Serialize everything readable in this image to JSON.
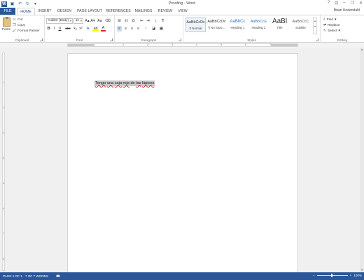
{
  "window": {
    "title": "Proofing - Word",
    "minimize": "–",
    "restore": "❐",
    "close": "✕",
    "help": "?",
    "ribbon_opts": "⊡"
  },
  "qat": {
    "word": "W",
    "save": "▣",
    "undo": "↶",
    "redo": "↻",
    "more": "▾"
  },
  "tabs": [
    {
      "label": "FILE"
    },
    {
      "label": "HOME"
    },
    {
      "label": "INSERT"
    },
    {
      "label": "DESIGN"
    },
    {
      "label": "PAGE LAYOUT"
    },
    {
      "label": "REFERENCES"
    },
    {
      "label": "MAILINGS"
    },
    {
      "label": "REVIEW"
    },
    {
      "label": "VIEW"
    }
  ],
  "user": {
    "name": "Brian Undendahl"
  },
  "clipboard": {
    "paste": "Paste",
    "cut": "Cut",
    "copy": "Copy",
    "format_painter": "Format Painter",
    "label": "Clipboard"
  },
  "font": {
    "name": "Calibri (Body)",
    "size": "11",
    "label": "Font",
    "grow": "A▴",
    "shrink": "A▾",
    "case": "Aa",
    "clear": "⌫",
    "bold": "B",
    "italic": "I",
    "underline": "U",
    "strike": "abc",
    "subscript": "x₂",
    "superscript": "x²",
    "effects": "A",
    "highlight": "ab",
    "color": "A"
  },
  "paragraph": {
    "label": "Paragraph",
    "bullets": "☰",
    "numbering": "☷",
    "multilevel": "☲",
    "decrease": "⇤",
    "increase": "⇥",
    "sort": "↕",
    "show": "¶",
    "align_left": "≡",
    "center": "≡",
    "align_right": "≡",
    "justify": "≡",
    "spacing": "↕",
    "shading": "◪",
    "borders": "▦"
  },
  "styles": {
    "label": "Styles",
    "items": [
      {
        "preview": "AaBbCcDc",
        "name": "¶ Normal"
      },
      {
        "preview": "AaBbCcDc",
        "name": "¶ No Spac..."
      },
      {
        "preview": "AaBbCc",
        "name": "Heading 1"
      },
      {
        "preview": "AaBbCcE",
        "name": "Heading 2"
      },
      {
        "preview": "AaBl",
        "name": "Title"
      },
      {
        "preview": "AaBbCcC",
        "name": "Subtitle"
      }
    ]
  },
  "editing": {
    "label": "Editing",
    "find": "Find",
    "replace": "Replace",
    "select": "Select"
  },
  "ruler": {
    "h": [
      "1",
      "2",
      "3",
      "4",
      "5",
      "6",
      "7"
    ],
    "v": [
      "1",
      "2",
      "3",
      "4",
      "5",
      "6",
      "7",
      "8"
    ]
  },
  "document": {
    "words": [
      {
        "text": "Tengo",
        "squiggle": true
      },
      {
        "text": "una",
        "squiggle": true
      },
      {
        "text": "caja",
        "squiggle": true
      },
      {
        "text": "roja",
        "squiggle": true
      },
      {
        "text": "de",
        "squiggle": false
      },
      {
        "text": "las",
        "squiggle": true
      },
      {
        "text": "lápices",
        "squiggle": true
      }
    ]
  },
  "status": {
    "page": "PAGE 1 OF 1",
    "words": "7 OF 7 WORDS",
    "zoom_minus": "–",
    "zoom_plus": "+",
    "zoom": "100%"
  },
  "colors": {
    "accent": "#2b579a",
    "highlight": "#c9c9c9",
    "squiggle": "#d12a2a"
  }
}
